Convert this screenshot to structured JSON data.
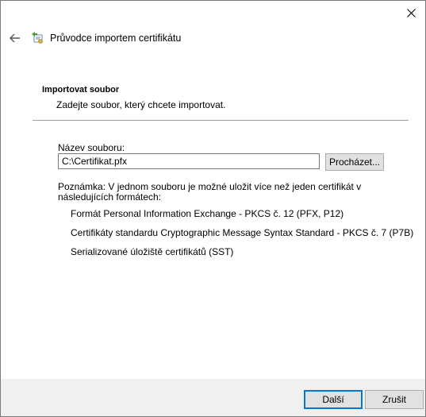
{
  "window": {
    "title": "Průvodce importem certifikátu",
    "close_icon": "close-icon",
    "back_icon": "back-arrow-icon",
    "wizard_icon": "certificate-wizard-icon"
  },
  "section": {
    "title": "Importovat soubor",
    "description": "Zadejte soubor, který chcete importovat."
  },
  "file": {
    "label": "Název souboru:",
    "value": "C:\\Certifikat.pfx",
    "browse_label": "Procházet..."
  },
  "note": {
    "text": "Poznámka: V jednom souboru je možné uložit více než jeden certifikát v následujících formátech:",
    "formats": [
      "Formát Personal Information Exchange - PKCS č. 12 (PFX, P12)",
      "Certifikáty standardu Cryptographic Message Syntax Standard - PKCS č. 7 (P7B)",
      "Serializované úložiště certifikátů (SST)"
    ]
  },
  "buttons": {
    "next_label": "Další",
    "cancel_label": "Zrušit"
  },
  "colors": {
    "accent": "#0078d7",
    "footer_bg": "#f0f0f0",
    "button_bg": "#e1e1e1"
  }
}
